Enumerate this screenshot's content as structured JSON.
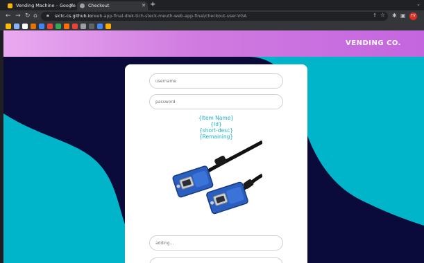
{
  "browser": {
    "tabs": [
      {
        "title": "Vending Machine – Google Slid",
        "active": false,
        "favicon_color": "#f4b400"
      },
      {
        "title": "Checkout",
        "active": true,
        "favicon_color": "#9aa0a6"
      }
    ],
    "url_host": "sictc-cs.github.io",
    "url_path": "/web-app-final-dlek-tich-steck-meuth-web-app-final/checkout-user-VGA",
    "profile_initials": "TV",
    "bookmark_colors": [
      "#fbbc04",
      "#8ab4f8",
      "#ffffff",
      "#e37400",
      "#4285f4",
      "#ea4335",
      "#34a853",
      "#ff6d00",
      "#ea4335",
      "#9aa0a6",
      "#5f6368",
      "#4285f4",
      "#f9ab00"
    ]
  },
  "header": {
    "brand": "VENDING CO."
  },
  "form": {
    "username_placeholder": "username",
    "password_placeholder": "password",
    "adding_placeholder": "adding...",
    "fourth_placeholder": ""
  },
  "product": {
    "name": "{Item Name}",
    "id": "{Id}",
    "short_desc": "{short-desc}",
    "remaining": "{Remaining}",
    "image": "vga-cable-icon"
  },
  "colors": {
    "header_start": "#e9aaf0",
    "header_end": "#c466df",
    "background_dark": "#0b0b3b",
    "wave_teal": "#00b4c9",
    "info_text": "#1ab4c6"
  }
}
